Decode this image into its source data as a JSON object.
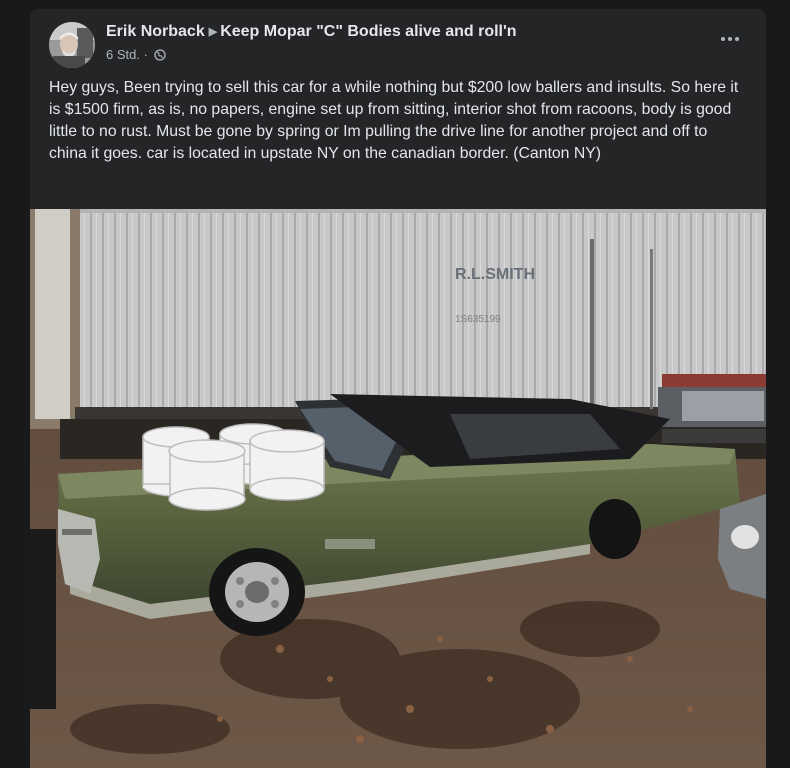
{
  "post": {
    "author": "Erik Norback",
    "group": "Keep Mopar \"C\" Bodies alive and roll'n",
    "timestamp": "6 Std. ·",
    "privacy_icon": "globe-icon",
    "body": "Hey guys, Been trying to sell this car for a while nothing but $200 low ballers and insults. So here it is $1500 firm, as is, no papers, engine set up from sitting, interior shot from racoons, body is good little to no rust. Must be gone by spring or Im pulling the drive line for another project and off to china it goes. car is located in upstate NY on the canadian border. (Canton NY)",
    "photo": {
      "trailer_text_1": "R.L.SMITH",
      "trailer_text_2": "1S635199",
      "alt": "Green convertible parked next to a trailer with white wheels on its hood"
    }
  },
  "colors": {
    "page_bg": "#18191a",
    "card_bg": "#242526",
    "text_primary": "#e4e6eb",
    "text_secondary": "#b0b3b8"
  }
}
